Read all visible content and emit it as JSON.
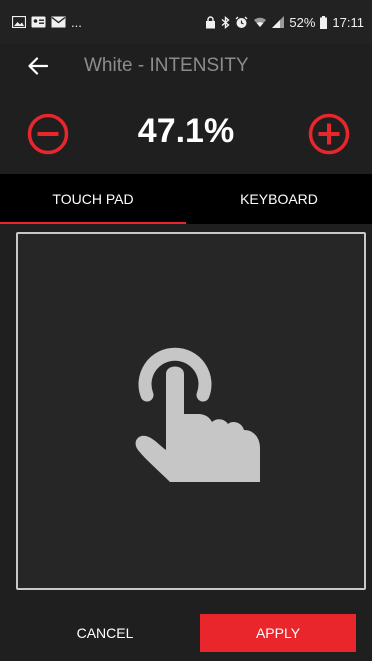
{
  "status_bar": {
    "left_icons": [
      "image-icon",
      "contact-card-icon",
      "mail-icon"
    ],
    "overflow": "...",
    "right_icons": [
      "lock-icon",
      "bluetooth-icon",
      "alarm-icon",
      "wifi-icon",
      "signal-icon"
    ],
    "battery": "52%",
    "time": "17:11"
  },
  "app_bar": {
    "back_icon": "arrow-left-icon",
    "title": "White - INTENSITY"
  },
  "value": {
    "display": "47.1%",
    "minus_icon": "minus-circle-icon",
    "plus_icon": "plus-circle-icon"
  },
  "tabs": [
    {
      "label": "TOUCH PAD",
      "active": true
    },
    {
      "label": "KEYBOARD",
      "active": false
    }
  ],
  "touchpad": {
    "icon": "touch-gesture-icon"
  },
  "actions": {
    "cancel_label": "CANCEL",
    "apply_label": "APPLY"
  },
  "colors": {
    "accent": "#e8262b",
    "background": "#1f1f1f",
    "tab_bar": "#000000",
    "title_text": "#8c8c8c",
    "icon_gray": "#c6c6c6"
  }
}
